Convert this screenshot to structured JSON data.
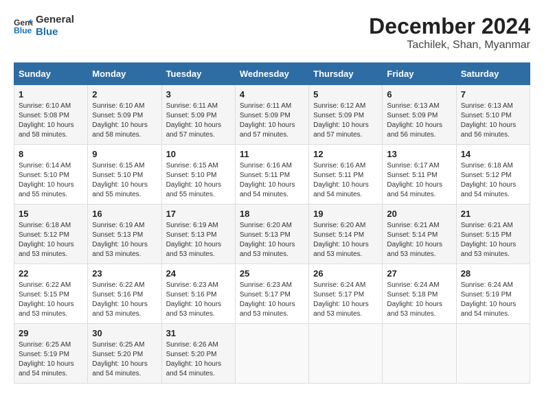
{
  "logo": {
    "line1": "General",
    "line2": "Blue"
  },
  "title": "December 2024",
  "subtitle": "Tachilek, Shan, Myanmar",
  "days_header": [
    "Sunday",
    "Monday",
    "Tuesday",
    "Wednesday",
    "Thursday",
    "Friday",
    "Saturday"
  ],
  "weeks": [
    [
      {
        "day": "1",
        "sunrise": "6:10 AM",
        "sunset": "5:08 PM",
        "daylight": "10 hours and 58 minutes."
      },
      {
        "day": "2",
        "sunrise": "6:10 AM",
        "sunset": "5:09 PM",
        "daylight": "10 hours and 58 minutes."
      },
      {
        "day": "3",
        "sunrise": "6:11 AM",
        "sunset": "5:09 PM",
        "daylight": "10 hours and 57 minutes."
      },
      {
        "day": "4",
        "sunrise": "6:11 AM",
        "sunset": "5:09 PM",
        "daylight": "10 hours and 57 minutes."
      },
      {
        "day": "5",
        "sunrise": "6:12 AM",
        "sunset": "5:09 PM",
        "daylight": "10 hours and 57 minutes."
      },
      {
        "day": "6",
        "sunrise": "6:13 AM",
        "sunset": "5:09 PM",
        "daylight": "10 hours and 56 minutes."
      },
      {
        "day": "7",
        "sunrise": "6:13 AM",
        "sunset": "5:10 PM",
        "daylight": "10 hours and 56 minutes."
      }
    ],
    [
      {
        "day": "8",
        "sunrise": "6:14 AM",
        "sunset": "5:10 PM",
        "daylight": "10 hours and 55 minutes."
      },
      {
        "day": "9",
        "sunrise": "6:15 AM",
        "sunset": "5:10 PM",
        "daylight": "10 hours and 55 minutes."
      },
      {
        "day": "10",
        "sunrise": "6:15 AM",
        "sunset": "5:10 PM",
        "daylight": "10 hours and 55 minutes."
      },
      {
        "day": "11",
        "sunrise": "6:16 AM",
        "sunset": "5:11 PM",
        "daylight": "10 hours and 54 minutes."
      },
      {
        "day": "12",
        "sunrise": "6:16 AM",
        "sunset": "5:11 PM",
        "daylight": "10 hours and 54 minutes."
      },
      {
        "day": "13",
        "sunrise": "6:17 AM",
        "sunset": "5:11 PM",
        "daylight": "10 hours and 54 minutes."
      },
      {
        "day": "14",
        "sunrise": "6:18 AM",
        "sunset": "5:12 PM",
        "daylight": "10 hours and 54 minutes."
      }
    ],
    [
      {
        "day": "15",
        "sunrise": "6:18 AM",
        "sunset": "5:12 PM",
        "daylight": "10 hours and 53 minutes."
      },
      {
        "day": "16",
        "sunrise": "6:19 AM",
        "sunset": "5:13 PM",
        "daylight": "10 hours and 53 minutes."
      },
      {
        "day": "17",
        "sunrise": "6:19 AM",
        "sunset": "5:13 PM",
        "daylight": "10 hours and 53 minutes."
      },
      {
        "day": "18",
        "sunrise": "6:20 AM",
        "sunset": "5:13 PM",
        "daylight": "10 hours and 53 minutes."
      },
      {
        "day": "19",
        "sunrise": "6:20 AM",
        "sunset": "5:14 PM",
        "daylight": "10 hours and 53 minutes."
      },
      {
        "day": "20",
        "sunrise": "6:21 AM",
        "sunset": "5:14 PM",
        "daylight": "10 hours and 53 minutes."
      },
      {
        "day": "21",
        "sunrise": "6:21 AM",
        "sunset": "5:15 PM",
        "daylight": "10 hours and 53 minutes."
      }
    ],
    [
      {
        "day": "22",
        "sunrise": "6:22 AM",
        "sunset": "5:15 PM",
        "daylight": "10 hours and 53 minutes."
      },
      {
        "day": "23",
        "sunrise": "6:22 AM",
        "sunset": "5:16 PM",
        "daylight": "10 hours and 53 minutes."
      },
      {
        "day": "24",
        "sunrise": "6:23 AM",
        "sunset": "5:16 PM",
        "daylight": "10 hours and 53 minutes."
      },
      {
        "day": "25",
        "sunrise": "6:23 AM",
        "sunset": "5:17 PM",
        "daylight": "10 hours and 53 minutes."
      },
      {
        "day": "26",
        "sunrise": "6:24 AM",
        "sunset": "5:17 PM",
        "daylight": "10 hours and 53 minutes."
      },
      {
        "day": "27",
        "sunrise": "6:24 AM",
        "sunset": "5:18 PM",
        "daylight": "10 hours and 53 minutes."
      },
      {
        "day": "28",
        "sunrise": "6:24 AM",
        "sunset": "5:19 PM",
        "daylight": "10 hours and 54 minutes."
      }
    ],
    [
      {
        "day": "29",
        "sunrise": "6:25 AM",
        "sunset": "5:19 PM",
        "daylight": "10 hours and 54 minutes."
      },
      {
        "day": "30",
        "sunrise": "6:25 AM",
        "sunset": "5:20 PM",
        "daylight": "10 hours and 54 minutes."
      },
      {
        "day": "31",
        "sunrise": "6:26 AM",
        "sunset": "5:20 PM",
        "daylight": "10 hours and 54 minutes."
      },
      null,
      null,
      null,
      null
    ]
  ],
  "labels": {
    "sunrise": "Sunrise:",
    "sunset": "Sunset:",
    "daylight": "Daylight:"
  }
}
